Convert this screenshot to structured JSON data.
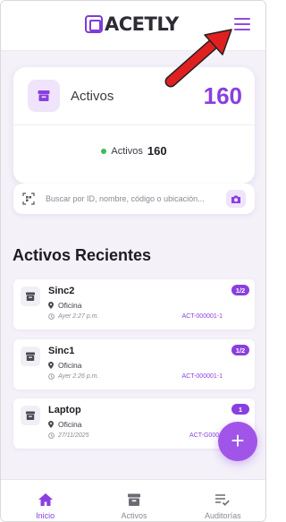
{
  "header": {
    "brand": "ACETLY",
    "menu_icon": "hamburger-menu-icon"
  },
  "stats": {
    "label": "Activos",
    "value": "160",
    "footer_label": "Activos",
    "footer_value": "160",
    "status_color": "#3bbb5c"
  },
  "search": {
    "placeholder": "Buscar por ID, nombre, código o ubicación...",
    "scan_icon": "qr-scan-icon",
    "camera_icon": "camera-icon"
  },
  "recent": {
    "title": "Activos Recientes",
    "items": [
      {
        "name": "Sinc2",
        "location": "Oficina",
        "date": "Ayer 2:27 p.m.",
        "code": "ACT-000001-1",
        "badge": "1/2"
      },
      {
        "name": "Sinc1",
        "location": "Oficina",
        "date": "Ayer 2:26 p.m.",
        "code": "ACT-000001-1",
        "badge": "1/2"
      },
      {
        "name": "Laptop",
        "location": "Oficina",
        "date": "27/11/2025",
        "code": "ACT-G0001",
        "badge": "1"
      }
    ]
  },
  "fab": {
    "label": "+"
  },
  "nav": {
    "items": [
      {
        "label": "Inicio",
        "icon": "home-icon",
        "active": true
      },
      {
        "label": "Activos",
        "icon": "archive-box-icon",
        "active": false
      },
      {
        "label": "Auditorías",
        "icon": "checklist-icon",
        "active": false
      }
    ]
  },
  "colors": {
    "accent": "#8a3fe0",
    "background": "#f4f1f9",
    "annotation_arrow": "#e02020"
  }
}
